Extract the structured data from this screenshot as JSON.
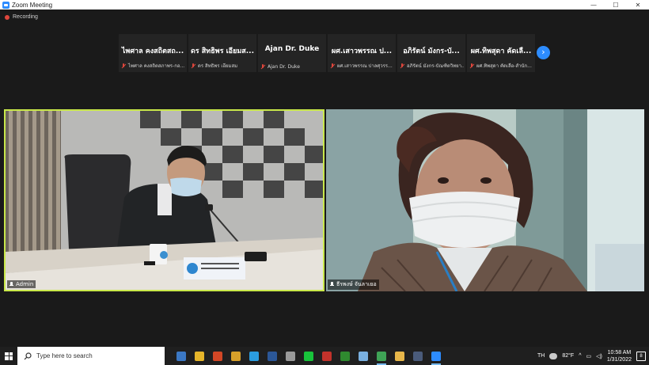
{
  "window": {
    "title": "Zoom Meeting",
    "minimize": "—",
    "maximize": "☐",
    "close": "✕"
  },
  "meeting": {
    "recording_label": "Recording",
    "thumbnails": [
      {
        "display": "ไพศาล คงสถิตสถ...",
        "name": "ไพศาล คงสถิตสภาพร-กอ..."
      },
      {
        "display": "ดร สิทธิพร เอียมส...",
        "name": "ดร สิทธิพร เอียมสม"
      },
      {
        "display": "Ajan Dr. Duke",
        "name": "Ajan Dr. Duke"
      },
      {
        "display": "ผศ.เสาวพรรณ ป...",
        "name": "ผศ.เสาวพรรณ ปาลศุวรร..."
      },
      {
        "display": "อภิรัตน์ มังกร-บั...",
        "name": "อภิรัตน์ มังกร-บัณฑิตวิทยา..."
      },
      {
        "display": "ผศ.ทิพสุดา คัดเลื...",
        "name": "ผศ.ทิพสุดา คัดเลือ-สำนัก..."
      }
    ],
    "next_page_icon": "chevron-right-icon",
    "speaker_left": {
      "name": "Admin"
    },
    "speaker_right": {
      "name": "ธีรพงษ์ จันลาเยอ"
    },
    "active_speaker_color": "#c9e84a"
  },
  "taskbar": {
    "search_placeholder": "Type here to search",
    "apps": [
      {
        "icon": "file-manager-icon",
        "color": "#3b78c4"
      },
      {
        "icon": "chrome-icon",
        "color": "#e6b52a"
      },
      {
        "icon": "powerpoint-icon",
        "color": "#d24726"
      },
      {
        "icon": "media-player-icon",
        "color": "#d7a02a"
      },
      {
        "icon": "edge-icon",
        "color": "#2b9de0"
      },
      {
        "icon": "word-icon",
        "color": "#2b5797"
      },
      {
        "icon": "usb-icon",
        "color": "#9a9a9a"
      },
      {
        "icon": "line-icon",
        "color": "#18c33b"
      },
      {
        "icon": "red-app-icon",
        "color": "#c2322b"
      },
      {
        "icon": "xbox-icon",
        "color": "#2f8a2f"
      },
      {
        "icon": "notepad-icon",
        "color": "#7ab0e0"
      },
      {
        "icon": "chrome-2-icon",
        "color": "#3fa356"
      },
      {
        "icon": "folder-icon",
        "color": "#e8b74a"
      },
      {
        "icon": "word-2-icon",
        "color": "#4a5b7a"
      },
      {
        "icon": "zoom-icon",
        "color": "#2d8cff"
      }
    ],
    "language": "TH",
    "weather": "82°F",
    "time": "10:58 AM",
    "date": "1/31/2022",
    "notification_count": "8"
  }
}
